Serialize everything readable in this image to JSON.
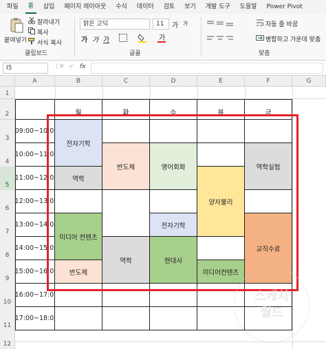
{
  "menu": {
    "tabs": [
      "파일",
      "홈",
      "삽입",
      "페이지 레이아웃",
      "수식",
      "데이터",
      "검토",
      "보기",
      "개발 도구",
      "도움말",
      "Power Pivot"
    ],
    "active": 1
  },
  "ribbon": {
    "paste": "붙여넣기",
    "cut": "잘라내기",
    "copy": "복사",
    "format_painter": "서식 복사",
    "clipboard_group": "클립보드",
    "font_name": "맑은 고딕",
    "font_size": "11",
    "grow": "가",
    "shrink": "가",
    "bold": "가",
    "italic": "가",
    "underline": "가",
    "font_group": "글꼴",
    "wrap": "자동 줄 바꿈",
    "merge": "병합하고 가운데 맞춤",
    "align_group": "맞춤",
    "accent": "#0f6b3c",
    "red": "#e4222a",
    "yellow": "#ffd200"
  },
  "formula": {
    "namebox": "I5",
    "fx": "fx",
    "value": ""
  },
  "columns": [
    "A",
    "B",
    "C",
    "D",
    "E",
    "F",
    "G"
  ],
  "rows": [
    "1",
    "2",
    "3",
    "4",
    "5",
    "6",
    "7",
    "8",
    "9",
    "10",
    "11",
    "12"
  ],
  "days": [
    "월",
    "화",
    "수",
    "목",
    "금"
  ],
  "times": [
    "09:00~10:00",
    "10:00~11:00",
    "11:00~12:00",
    "12:00~13:00",
    "13:00~14:00",
    "14:00~15:00",
    "15:00~16:00",
    "16:00~17:00",
    "17:00~18:00"
  ],
  "classes": {
    "mon_electronic": "전자기학",
    "mon_optics": "역학",
    "mon_media": "미디어 컨텐츠",
    "mon_semi": "반도체",
    "tue_semi": "반도체",
    "tue_optics": "역학",
    "wed_english": "영어회화",
    "wed_electronic": "전자기학",
    "wed_modern": "현대사",
    "thu_quantum": "양자물리",
    "thu_media": "미디어컨텐츠",
    "fri_lab": "역학실험",
    "fri_teach": "교직수료"
  },
  "colors": {
    "blue": "#dce3f4",
    "grey": "#dcdcdc",
    "green": "#a8d08d",
    "peach": "#fbe2d5",
    "lightgreen": "#e2efdb",
    "yellow": "#ffe699",
    "orange": "#f4b183"
  },
  "watermark": {
    "line1": "스케치",
    "line2": "월드"
  }
}
